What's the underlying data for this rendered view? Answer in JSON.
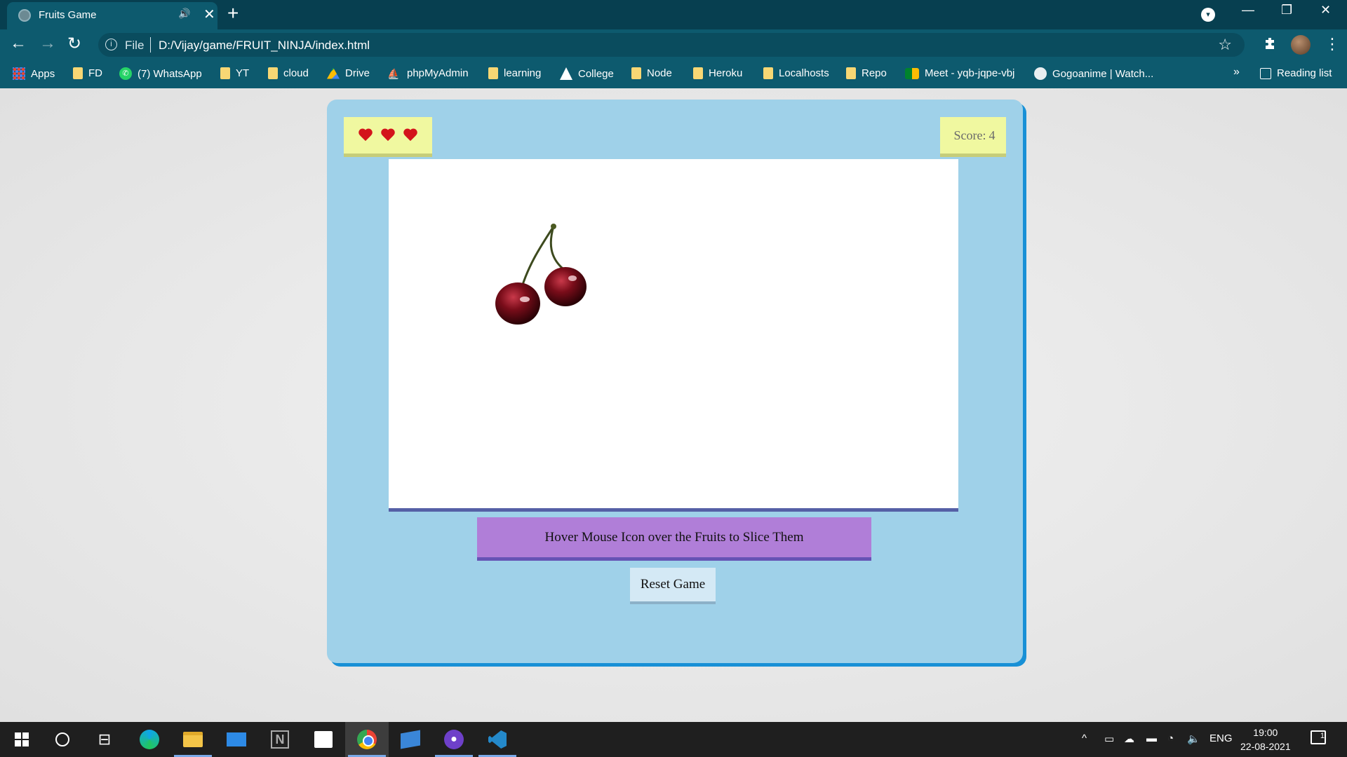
{
  "browser": {
    "tab_title": "Fruits Game",
    "tab_audio": "🔊",
    "tab_close": "✕",
    "new_tab": "+",
    "profile_dropdown": "▾",
    "window_controls": {
      "minimize": "—",
      "restore": "❐",
      "close": "✕"
    },
    "nav": {
      "back": "←",
      "forward": "→",
      "reload": "↻"
    },
    "address": {
      "info": "i",
      "scheme": "File",
      "url": "D:/Vijay/game/FRUIT_NINJA/index.html",
      "star": "☆"
    },
    "extensions_icon": "puzzle-icon",
    "menu": "⋮",
    "bookmarks": [
      {
        "label": "Apps",
        "icon": "apps-grid-icon"
      },
      {
        "label": "FD",
        "icon": "folder-icon"
      },
      {
        "label": "(7) WhatsApp",
        "icon": "whatsapp-icon"
      },
      {
        "label": "YT",
        "icon": "folder-icon"
      },
      {
        "label": "cloud",
        "icon": "folder-icon"
      },
      {
        "label": "Drive",
        "icon": "drive-icon"
      },
      {
        "label": "phpMyAdmin",
        "icon": "phpmyadmin-icon"
      },
      {
        "label": "learning",
        "icon": "folder-icon"
      },
      {
        "label": "College",
        "icon": "college-icon"
      },
      {
        "label": "Node",
        "icon": "folder-icon"
      },
      {
        "label": "Heroku",
        "icon": "folder-icon"
      },
      {
        "label": "Localhosts",
        "icon": "folder-icon"
      },
      {
        "label": "Repo",
        "icon": "folder-icon"
      },
      {
        "label": "Meet - yqb-jqpe-vbj",
        "icon": "meet-icon"
      },
      {
        "label": "Gogoanime | Watch...",
        "icon": "gogoanime-icon"
      }
    ],
    "bookmarks_more": "»",
    "reading_list": "Reading list"
  },
  "game": {
    "lives": 3,
    "score_label": "Score:",
    "score_value": "4",
    "fruit": "cherry",
    "instruction": "Hover Mouse Icon over the Fruits to Slice Them",
    "reset_label": "Reset Game",
    "colors": {
      "container": "#9fd1e9",
      "container_shadow": "#1890d6",
      "hud": "#f0f8a0",
      "instruction_bg": "#b07ed8",
      "heart": "#d3141b"
    }
  },
  "taskbar": {
    "apps": [
      "windows-start-icon",
      "search-icon",
      "task-view-icon",
      "edge-icon",
      "file-explorer-icon",
      "mail-icon",
      "notion-icon",
      "store-icon",
      "chrome-icon",
      "remote-desktop-icon",
      "github-desktop-icon",
      "vscode-icon"
    ],
    "tray": {
      "chevron": "^",
      "language": "ENG"
    },
    "time": "19:00",
    "date": "22-08-2021",
    "notification_count": "1"
  }
}
